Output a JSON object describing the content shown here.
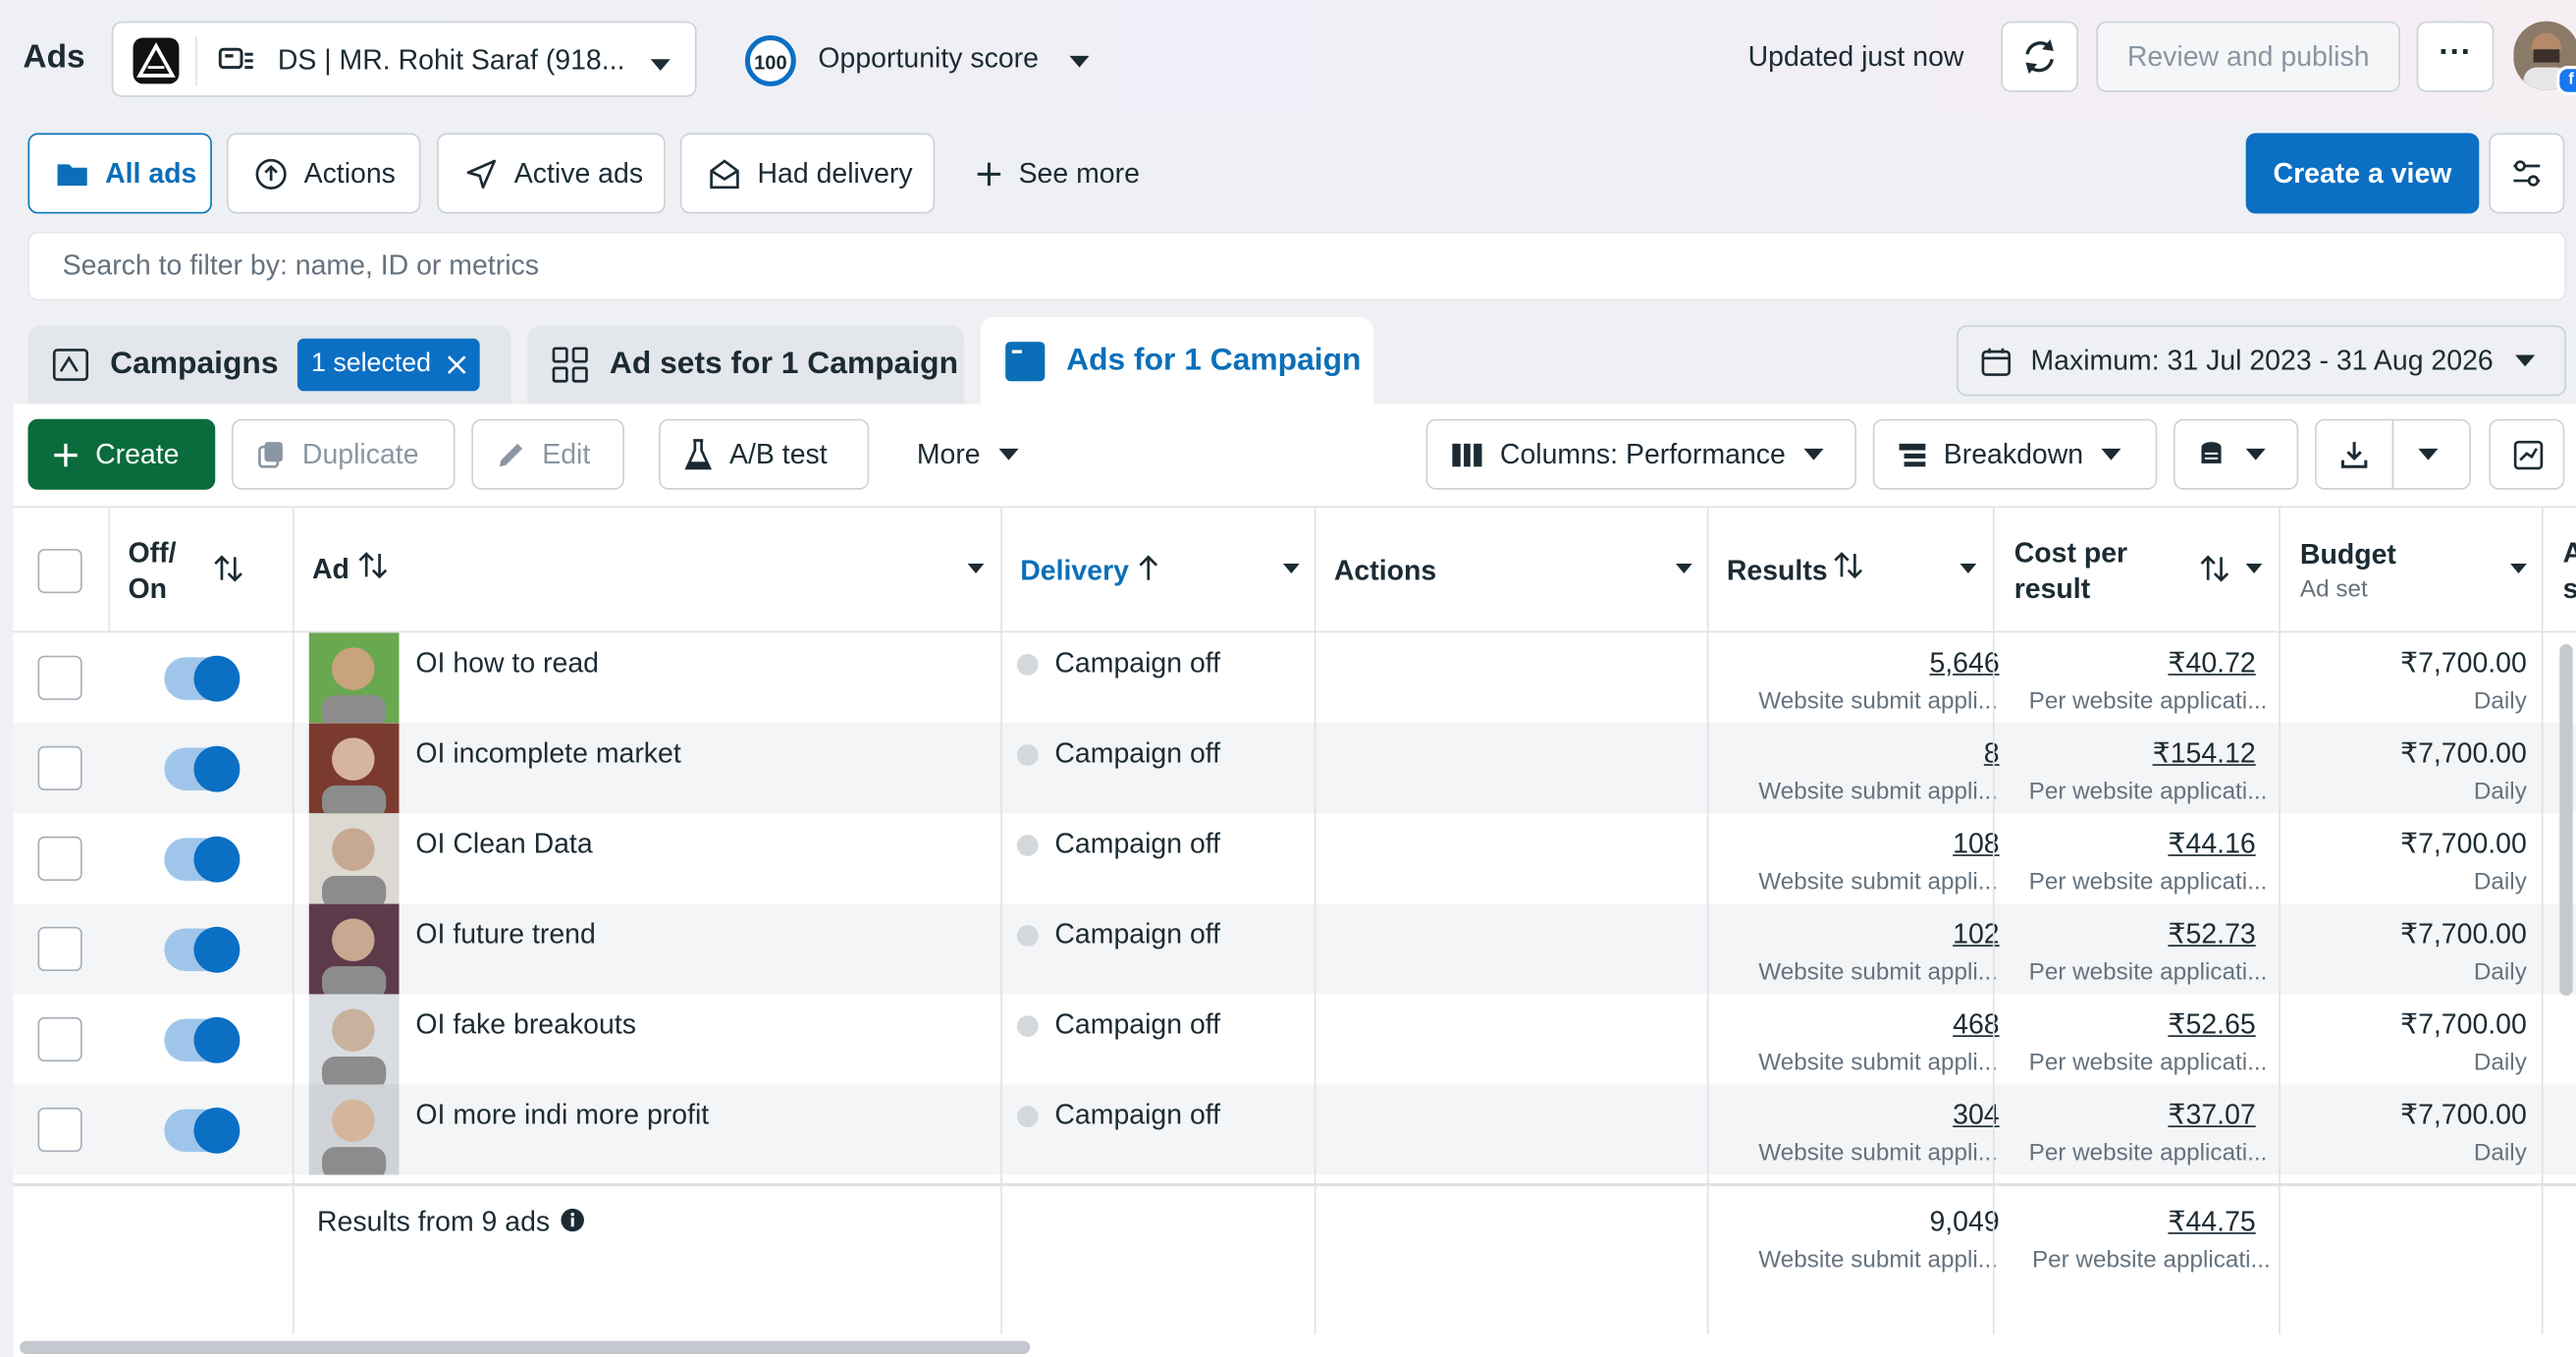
{
  "header": {
    "brand": "Ads",
    "account_name": "DS | MR. Rohit Saraf (918...",
    "opportunity_score": "100",
    "opportunity_label": "Opportunity score",
    "updated": "Updated just now",
    "review_publish": "Review and publish",
    "more_glyph": "···"
  },
  "views": {
    "items": [
      "All ads",
      "Actions",
      "Active ads",
      "Had delivery"
    ],
    "see_more": "See more",
    "create_view": "Create a view"
  },
  "search": {
    "placeholder": "Search to filter by: name, ID or metrics"
  },
  "tabs": {
    "campaigns": "Campaigns",
    "selected_badge": "1 selected",
    "adsets": "Ad sets for 1 Campaign",
    "ads": "Ads for 1 Campaign"
  },
  "date_range": "Maximum: 31 Jul 2023 - 31 Aug 2026",
  "toolbar": {
    "create": "Create",
    "duplicate": "Duplicate",
    "edit": "Edit",
    "ab_test": "A/B test",
    "more": "More",
    "columns": "Columns: Performance",
    "breakdown": "Breakdown"
  },
  "table": {
    "headers": {
      "off_on_1": "Off/",
      "off_on_2": "On",
      "ad": "Ad",
      "delivery": "Delivery",
      "actions": "Actions",
      "results": "Results",
      "cost_1": "Cost per",
      "cost_2": "result",
      "budget": "Budget",
      "budget_sub": "Ad set",
      "next_1": "A",
      "next_2": "s"
    },
    "rows": [
      {
        "name": "OI how to read",
        "delivery": "Campaign off",
        "results": "5,646",
        "results_sub": "Website submit appli...",
        "cost": "₹40.72",
        "cost_sub": "Per website applicati...",
        "budget": "₹7,700.00",
        "budget_sub": "Daily"
      },
      {
        "name": "OI incomplete market",
        "delivery": "Campaign off",
        "results": "8",
        "results_sub": "Website submit appli...",
        "cost": "₹154.12",
        "cost_sub": "Per website applicati...",
        "budget": "₹7,700.00",
        "budget_sub": "Daily"
      },
      {
        "name": "OI Clean Data",
        "delivery": "Campaign off",
        "results": "108",
        "results_sub": "Website submit appli...",
        "cost": "₹44.16",
        "cost_sub": "Per website applicati...",
        "budget": "₹7,700.00",
        "budget_sub": "Daily"
      },
      {
        "name": "OI future trend",
        "delivery": "Campaign off",
        "results": "102",
        "results_sub": "Website submit appli...",
        "cost": "₹52.73",
        "cost_sub": "Per website applicati...",
        "budget": "₹7,700.00",
        "budget_sub": "Daily"
      },
      {
        "name": "OI fake breakouts",
        "delivery": "Campaign off",
        "results": "468",
        "results_sub": "Website submit appli...",
        "cost": "₹52.65",
        "cost_sub": "Per website applicati...",
        "budget": "₹7,700.00",
        "budget_sub": "Daily"
      },
      {
        "name": "OI more indi more profit",
        "delivery": "Campaign off",
        "results": "304",
        "results_sub": "Website submit appli...",
        "cost": "₹37.07",
        "cost_sub": "Per website applicati...",
        "budget": "₹7,700.00",
        "budget_sub": "Daily"
      }
    ],
    "footer": {
      "label": "Results from 9 ads",
      "results": "9,049",
      "results_sub": "Website submit appli...",
      "cost": "₹44.75",
      "cost_sub": "Per website applicati..."
    }
  },
  "colors": {
    "accent": "#0b6fc4",
    "create_green": "#0a6b3c"
  }
}
